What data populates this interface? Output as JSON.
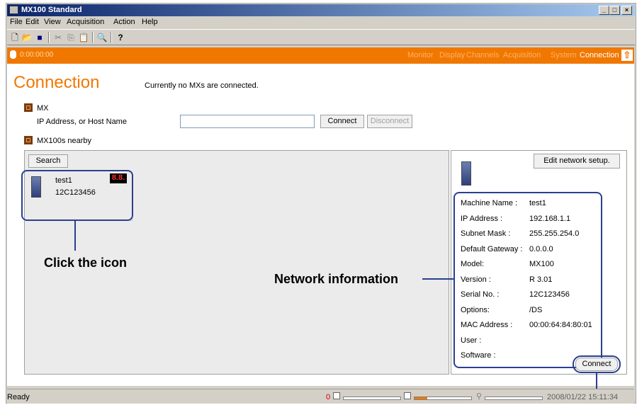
{
  "window": {
    "title": "MX100 Standard"
  },
  "menu": [
    "File",
    "Edit",
    "View",
    "Acquisition",
    "Action",
    "Help"
  ],
  "statusbar_top": {
    "time": "0:00:00:00"
  },
  "nav": {
    "items": [
      "Monitor",
      "Display",
      "Channels",
      "Acquisition",
      "System",
      "Connection"
    ],
    "active": "Connection"
  },
  "page": {
    "title": "Connection",
    "status_message": "Currently no MXs are connected."
  },
  "mx_section": {
    "label": "MX",
    "field_label": "IP Address, or Host Name",
    "ip_value": "",
    "connect_label": "Connect",
    "disconnect_label": "Disconnect"
  },
  "nearby_section": {
    "label": "MX100s nearby",
    "search_label": "Search"
  },
  "device": {
    "name": "test1",
    "serial": "12C123456",
    "display": "8.8."
  },
  "network": {
    "edit_label": "Edit network setup.",
    "rows": [
      {
        "label": "Machine Name :",
        "value": "test1"
      },
      {
        "label": "IP Address :",
        "value": "192.168.1.1"
      },
      {
        "label": "Subnet Mask :",
        "value": "255.255.254.0"
      },
      {
        "label": "Default Gateway :",
        "value": "0.0.0.0"
      },
      {
        "label": "Model:",
        "value": "MX100"
      },
      {
        "label": "Version :",
        "value": "R 3.01"
      },
      {
        "label": "Serial No. :",
        "value": "12C123456"
      },
      {
        "label": "Options:",
        "value": "/DS"
      },
      {
        "label": "MAC Address :",
        "value": "00:00:64:84:80:01"
      },
      {
        "label": "User :",
        "value": ""
      },
      {
        "label": "Software :",
        "value": ""
      }
    ],
    "connect_label": "Connect"
  },
  "annotations": {
    "click_icon": "Click the icon",
    "network_info": "Network information"
  },
  "status": {
    "text": "Ready",
    "count": "0",
    "datetime": "2008/01/22 15:11:34"
  },
  "colors": {
    "accent": "#f07800",
    "callout": "#2b3f8f"
  }
}
